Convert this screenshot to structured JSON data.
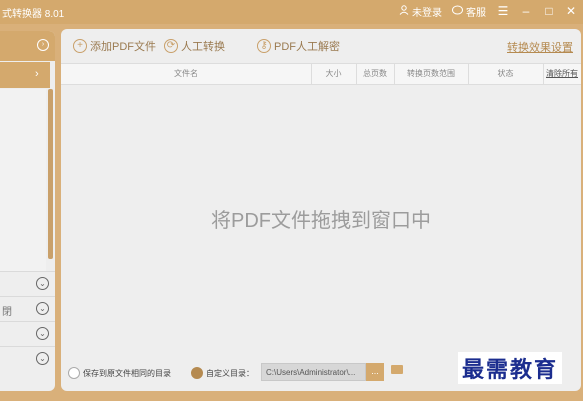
{
  "titlebar": {
    "title": "式转换器 8.01",
    "login": "未登录",
    "guide": "客服",
    "menu_icon": "hamburger-icon",
    "min_icon": "minimize-icon",
    "max_icon": "maximize-icon",
    "close_icon": "close-icon"
  },
  "sidebar": {
    "sub_items": [
      "",
      "閉",
      "",
      ""
    ]
  },
  "toolbar": {
    "add_pdf": "添加PDF文件",
    "manual": "人工转换",
    "decrypt": "PDF人工解密",
    "settings": "转换效果设置"
  },
  "table": {
    "headers": [
      "文件名",
      "大小",
      "总页数",
      "转换页数范围",
      "状态",
      "清除所有"
    ]
  },
  "drop_hint": "将PDF文件拖拽到窗口中",
  "footer": {
    "same_dir": "保存到原文件相同的目录",
    "custom_dir": "自定义目录：",
    "path": "C:\\Users\\Administrator\\...",
    "browse": "..."
  },
  "watermark": "最需教育",
  "colors": {
    "accent": "#d4a96d",
    "panel": "#eeeeee"
  }
}
